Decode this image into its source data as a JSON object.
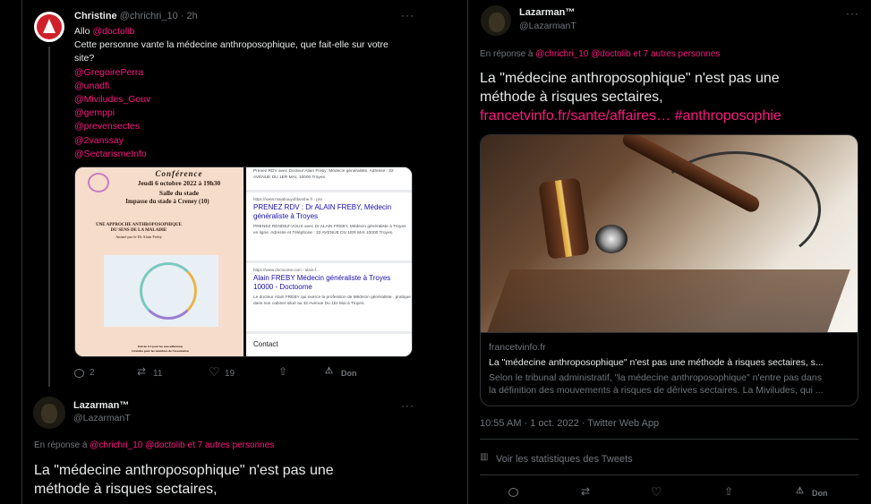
{
  "left": {
    "tweet1": {
      "name": "Christine",
      "handle": "@chrichri_10",
      "time": "· 2h",
      "greeting_prefix": "Allo",
      "greeting_mention": "@doctolib",
      "question_line1": "Cette personne vante la médecine anthroposophique, que fait-elle sur votre",
      "question_line2": "site?",
      "mentions": [
        "@GregoirePerra",
        "@unadfi",
        "@Miviludes_Gouv",
        "@gemppi",
        "@prevensectes",
        "@2vanssay",
        "@SectarismeInfo"
      ],
      "poster": {
        "title": "Conférence",
        "date": "Jeudi 6 octobre 2022 à 19h30",
        "venue": "Salle du stade",
        "address": "Impasse du stade à Creney (10)",
        "topic1": "UNE APPROCHE ANTHROPOSOPHIQUE",
        "topic2": "DU SENS DE LA MALADIE",
        "speaker": "Animé par le Dr Alain Freby",
        "footer1": "Entrée 6 € pour les non adhérents",
        "footer2": "Gratuite pour les membres de l'association"
      },
      "search": {
        "top_snippet": "Prenez RDV avec Docteur Alain Freby: Médecin généraliste. Adresse : 32 AVENUE DU 1ER MAI, 10000 Troyes.",
        "r1_url": "https://www.maiabouyofdanshe.fr › pra",
        "r1_title": "PRENEZ RDV : Dr ALAIN FREBY, Médecin généraliste à Troyes",
        "r1_desc": "PRENEZ RENDEZ-VOUS avec Dr ALAIN FREBY, Médecin généraliste à Troyes en ligne. Adresse et Téléphone : 32 AVENUE DU 1ER MAI 10000 Troyes.",
        "r2_url": "https://www.doctoome.com › alain-f...",
        "r2_title": "Alain FREBY Médecin généraliste à Troyes 10000 - Doctoome",
        "r2_desc": "Le docteur Alain FREBY qui exerce la profession de Médecin généraliste , pratique dans son cabinet situé au 32 Avenue Du 1Er Mai à Troyes.",
        "contact": "Contact"
      },
      "actions": {
        "replies": "2",
        "retweets": "11",
        "likes": "19",
        "don": "Don"
      }
    },
    "tweet2": {
      "name": "Lazarman™",
      "handle": "@LazarmanT",
      "reply_prefix": "En réponse à",
      "reply_mentions": "@chrichri_10 @doctolib",
      "reply_others": "et 7 autres personnes",
      "text_line1": "La \"médecine anthroposophique\" n'est pas une",
      "text_line2": "méthode à risques sectaires,"
    }
  },
  "right": {
    "name": "Lazarman™",
    "handle": "@LazarmanT",
    "reply_prefix": "En réponse à",
    "reply_mentions": "@chrichri_10 @doctolib",
    "reply_others": "et 7 autres personnes",
    "text_line1": "La \"médecine anthroposophique\" n'est pas une",
    "text_line2": "méthode à risques sectaires,",
    "link": "francetvinfo.fr/sante/affaires…",
    "hashtag": "#anthroposophie",
    "card": {
      "domain": "francetvinfo.fr",
      "title": "La \"médecine anthroposophique\" n'est pas une méthode à risques sectaires, s...",
      "desc_line1": "Selon le tribunal administratif, \"la médecine anthroposophique\" n'entre pas dans",
      "desc_line2": "la définition des mouvements à risques de dérives sectaires. La Miviludes, qui ..."
    },
    "meta": "10:55 AM · 1 oct. 2022 · Twitter Web App",
    "stats": "Voir les statistiques des Tweets",
    "don": "Don"
  }
}
